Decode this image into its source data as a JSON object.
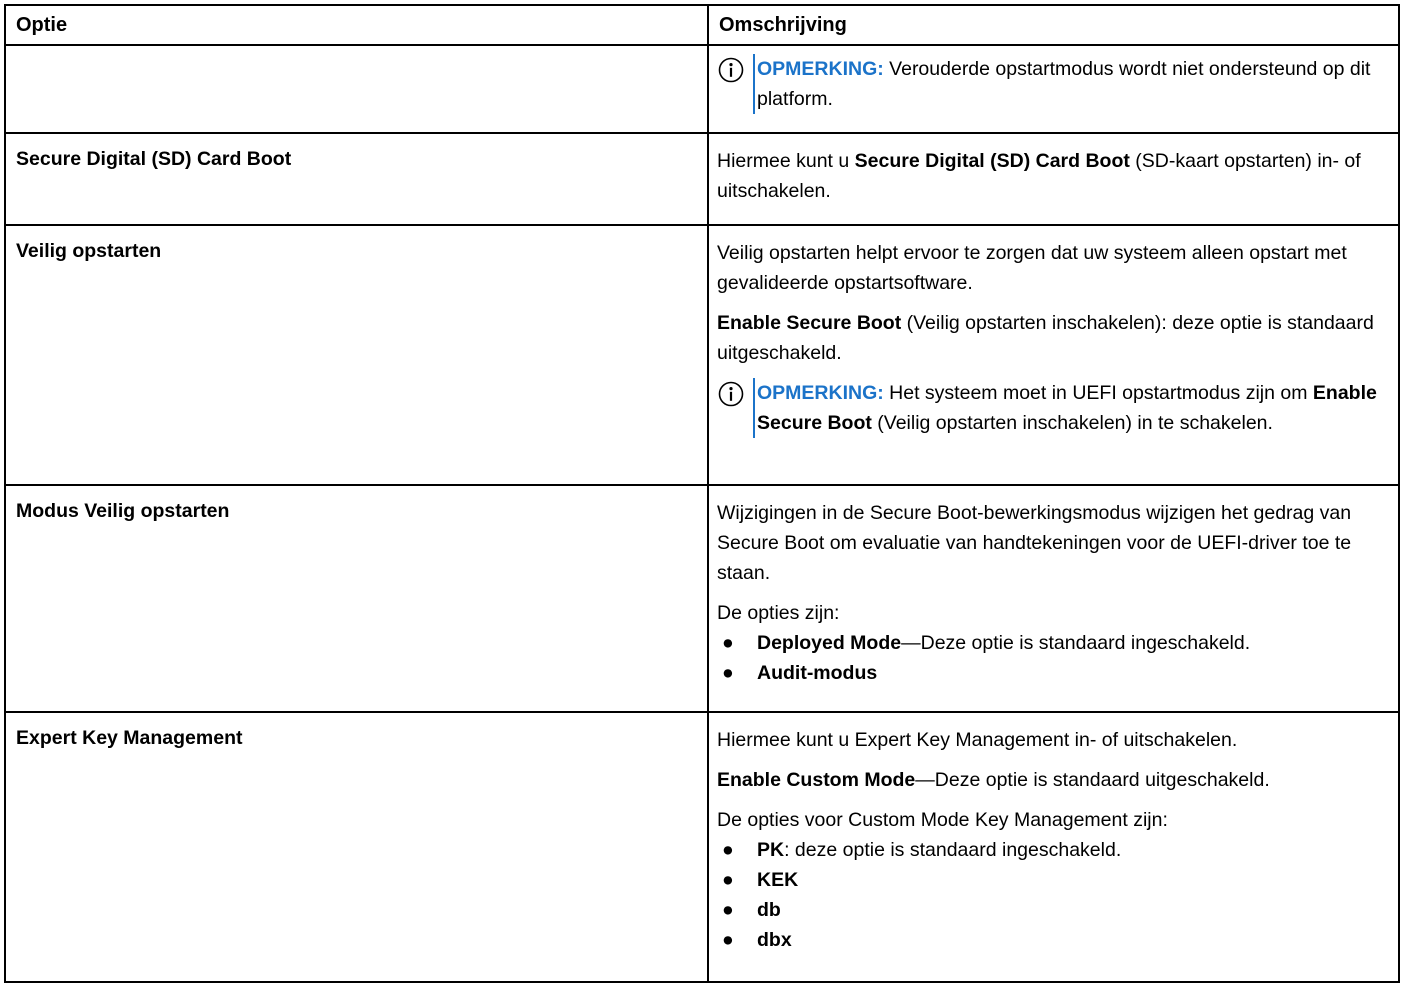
{
  "header": {
    "col1": "Optie",
    "col2": "Omschrijving"
  },
  "rows": [
    {
      "option": "",
      "note": {
        "label": "OPMERKING:",
        "text": " Verouderde opstartmodus wordt niet ondersteund op dit platform."
      }
    },
    {
      "option": "Secure Digital (SD) Card Boot",
      "p1_pre": "Hiermee kunt u ",
      "p1_bold": "Secure Digital (SD) Card Boot",
      "p1_post": " (SD-kaart opstarten) in- of uitschakelen."
    },
    {
      "option": "Veilig opstarten",
      "p1": "Veilig opstarten helpt ervoor te zorgen dat uw systeem alleen opstart met gevalideerde opstartsoftware.",
      "p2_bold": "Enable Secure Boot",
      "p2_post": " (Veilig opstarten inschakelen): deze optie is standaard uitgeschakeld.",
      "note": {
        "label": "OPMERKING:",
        "pre": " Het systeem moet in UEFI opstartmodus zijn om ",
        "bold": "Enable Secure Boot",
        "post": " (Veilig opstarten inschakelen) in te schakelen."
      }
    },
    {
      "option": "Modus Veilig opstarten",
      "p1": "Wijzigingen in de Secure Boot-bewerkingsmodus wijzigen het gedrag van Secure Boot om evaluatie van handtekeningen voor de UEFI-driver toe te staan.",
      "p2": "De opties zijn:",
      "items": [
        {
          "bold": "Deployed Mode",
          "text": "—Deze optie is standaard ingeschakeld."
        },
        {
          "bold": "Audit-modus",
          "text": ""
        }
      ]
    },
    {
      "option": "Expert Key Management",
      "p1": "Hiermee kunt u Expert Key Management in- of uitschakelen.",
      "p2_bold": "Enable Custom Mode",
      "p2_post": "—Deze optie is standaard uitgeschakeld.",
      "p3": "De opties voor Custom Mode Key Management zijn:",
      "items": [
        {
          "bold": "PK",
          "text": ": deze optie is standaard ingeschakeld."
        },
        {
          "bold": "KEK",
          "text": ""
        },
        {
          "bold": "db",
          "text": ""
        },
        {
          "bold": "dbx",
          "text": ""
        }
      ]
    }
  ],
  "bullet": "●",
  "icons": {
    "note": "info-circle-icon"
  },
  "colors": {
    "note_accent": "#1b73c9",
    "border": "#000000"
  }
}
